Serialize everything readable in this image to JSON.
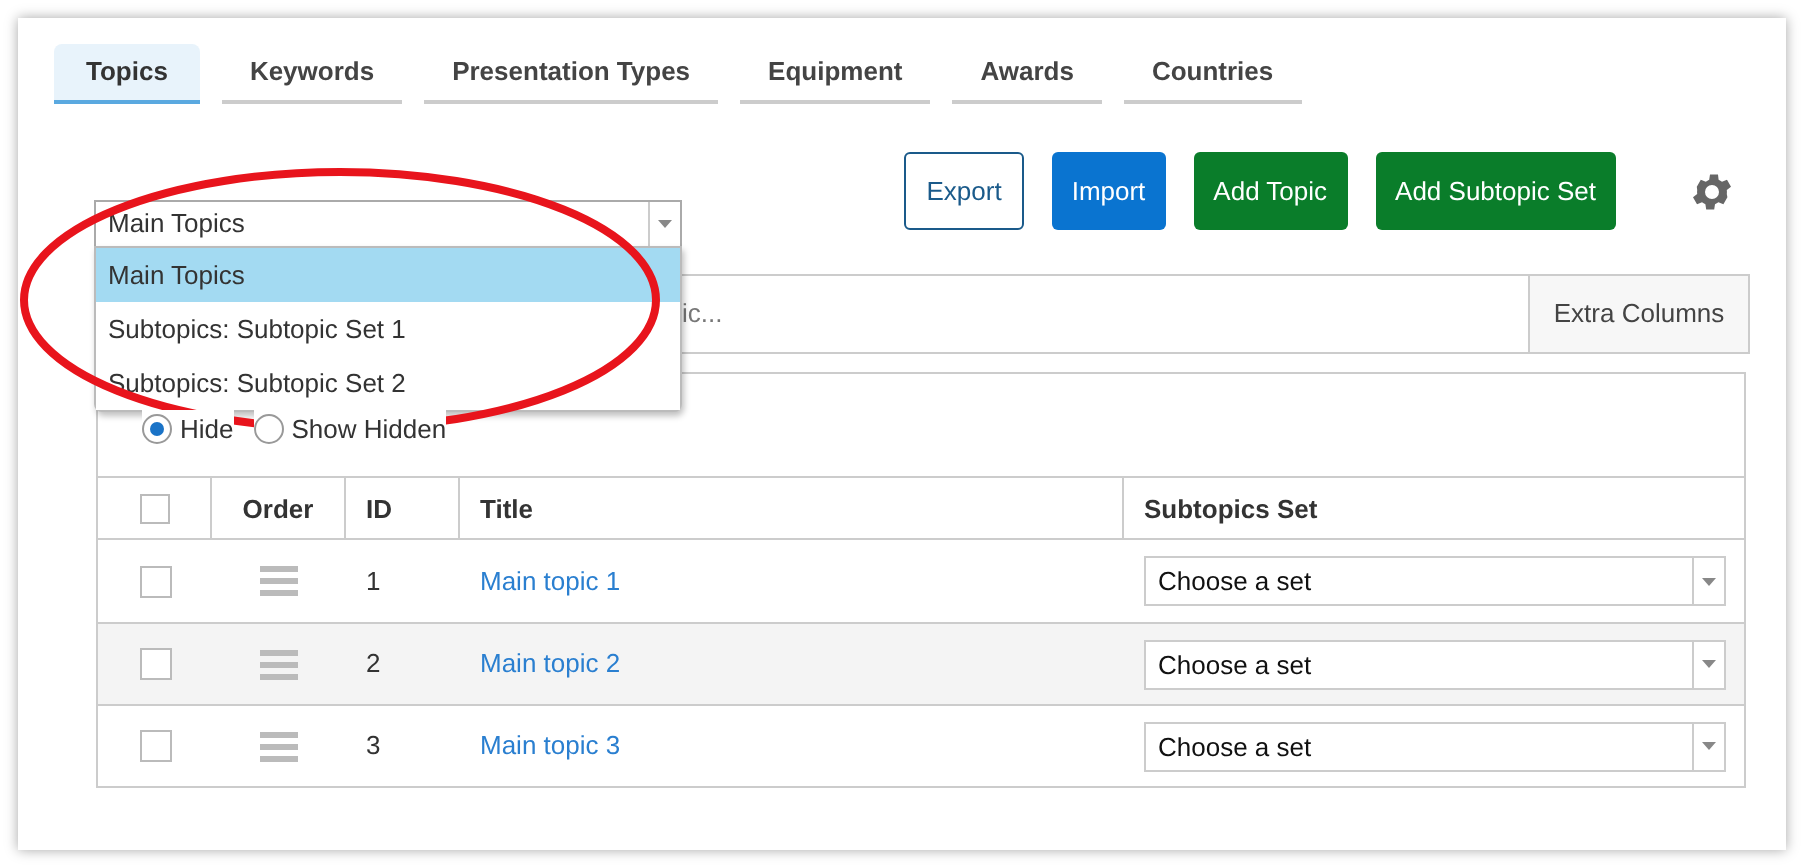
{
  "tabs": [
    {
      "label": "Topics",
      "selected": true
    },
    {
      "label": "Keywords",
      "selected": false
    },
    {
      "label": "Presentation Types",
      "selected": false
    },
    {
      "label": "Equipment",
      "selected": false
    },
    {
      "label": "Awards",
      "selected": false
    },
    {
      "label": "Countries",
      "selected": false
    }
  ],
  "topic_select": {
    "value": "Main Topics",
    "expanded": true,
    "options": [
      {
        "label": "Main Topics",
        "selected": true
      },
      {
        "label": "Subtopics: Subtopic Set 1",
        "selected": false
      },
      {
        "label": "Subtopics: Subtopic Set 2",
        "selected": false
      }
    ]
  },
  "buttons": [
    {
      "label": "Export",
      "kind": "outline"
    },
    {
      "label": "Import",
      "kind": "primary"
    },
    {
      "label": "Add Topic",
      "kind": "success"
    },
    {
      "label": "Add Subtopic Set",
      "kind": "success"
    }
  ],
  "search": {
    "placeholder": "ic..."
  },
  "extra_columns_button": "Extra Columns",
  "visibility_options": [
    {
      "label": "Hide",
      "selected": true
    },
    {
      "label": "Show Hidden",
      "selected": false
    }
  ],
  "table": {
    "select_all_checked": false,
    "columns": [
      "Order",
      "ID",
      "Title",
      "Subtopics Set"
    ],
    "rows": [
      {
        "checked": false,
        "id": "1",
        "title": "Main topic 1",
        "subtopic_set": "Choose a set"
      },
      {
        "checked": false,
        "id": "2",
        "title": "Main topic 2",
        "subtopic_set": "Choose a set"
      },
      {
        "checked": false,
        "id": "3",
        "title": "Main topic 3",
        "subtopic_set": "Choose a set"
      }
    ]
  }
}
